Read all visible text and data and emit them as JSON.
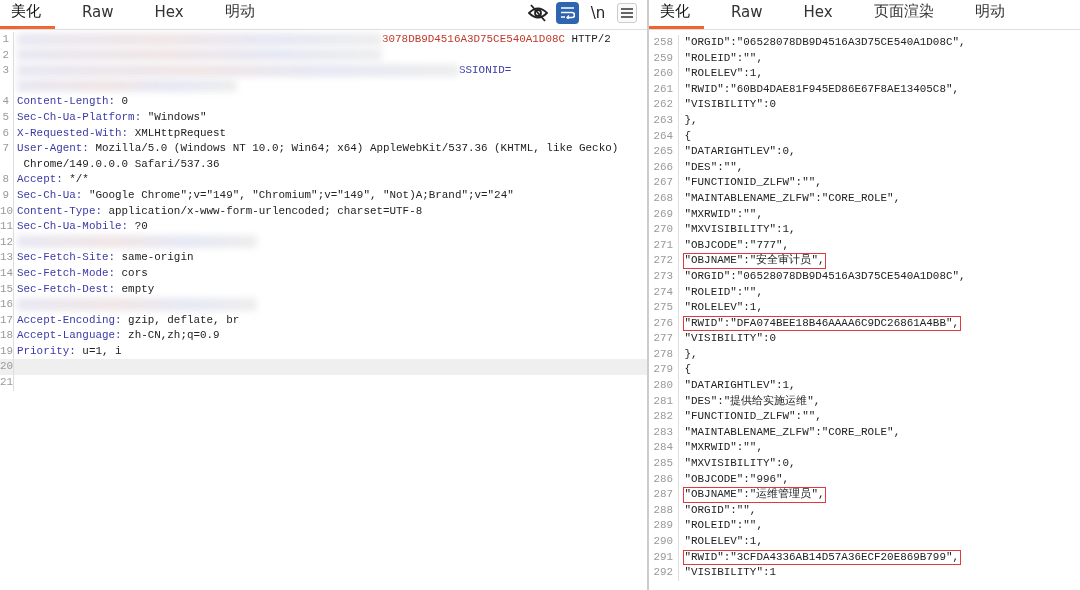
{
  "request": {
    "tabs": [
      {
        "label": "美化",
        "selected": true
      },
      {
        "label": "Raw",
        "selected": false
      },
      {
        "label": "Hex",
        "selected": false
      },
      {
        "label": "明动",
        "selected": false
      }
    ],
    "toolbar": {
      "wrap_on": true,
      "newline_label": "\\n"
    },
    "lines": [
      {
        "number": "1",
        "kind": "redacted-tail",
        "value": "3078DB9D4516A3D75CE540A1D08C",
        "suffix": " HTTP/2"
      },
      {
        "number": "2",
        "kind": "redacted"
      },
      {
        "number": "3",
        "kind": "redacted-key",
        "key": "SSIONID="
      },
      {
        "number": "4",
        "kind": "header",
        "key": "Content-Length:",
        "value": "0"
      },
      {
        "number": "5",
        "kind": "header",
        "key": "Sec-Ch-Ua-Platform:",
        "value": "\"Windows\""
      },
      {
        "number": "6",
        "kind": "header",
        "key": "X-Requested-With:",
        "value": "XMLHttpRequest"
      },
      {
        "number": "7",
        "kind": "header",
        "key": "User-Agent:",
        "value": "Mozilla/5.0 (Windows NT 10.0; Win64; x64) AppleWebKit/537.36 (KHTML, like Gecko)",
        "continuation": "Chrome/149.0.0.0 Safari/537.36"
      },
      {
        "number": "8",
        "kind": "header",
        "key": "Accept:",
        "value": "*/*"
      },
      {
        "number": "9",
        "kind": "header",
        "key": "Sec-Ch-Ua:",
        "value": "\"Google Chrome\";v=\"149\", \"Chromium\";v=\"149\", \"Not)A;Brand\";v=\"24\""
      },
      {
        "number": "10",
        "kind": "header",
        "key": "Content-Type:",
        "value": "application/x-www-form-urlencoded; charset=UTF-8"
      },
      {
        "number": "11",
        "kind": "header",
        "key": "Sec-Ch-Ua-Mobile:",
        "value": "?0"
      },
      {
        "number": "12",
        "kind": "redacted"
      },
      {
        "number": "13",
        "kind": "header",
        "key": "Sec-Fetch-Site:",
        "value": "same-origin"
      },
      {
        "number": "14",
        "kind": "header",
        "key": "Sec-Fetch-Mode:",
        "value": "cors"
      },
      {
        "number": "15",
        "kind": "header",
        "key": "Sec-Fetch-Dest:",
        "value": "empty"
      },
      {
        "number": "16",
        "kind": "redacted"
      },
      {
        "number": "17",
        "kind": "header",
        "key": "Accept-Encoding:",
        "value": "gzip, deflate, br"
      },
      {
        "number": "18",
        "kind": "header",
        "key": "Accept-Language:",
        "value": "zh-CN,zh;q=0.9"
      },
      {
        "number": "19",
        "kind": "header",
        "key": "Priority:",
        "value": "u=1, i"
      },
      {
        "number": "20",
        "kind": "empty",
        "current": true
      },
      {
        "number": "21",
        "kind": "empty",
        "current": false
      }
    ]
  },
  "response": {
    "tabs": [
      {
        "label": "美化",
        "selected": true
      },
      {
        "label": "Raw",
        "selected": false
      },
      {
        "label": "Hex",
        "selected": false
      },
      {
        "label": "页面渲染",
        "selected": false
      },
      {
        "label": "明动",
        "selected": false
      }
    ],
    "lines": [
      {
        "number": "258",
        "text": "\"ORGID\":\"06528078DB9D4516A3D75CE540A1D08C\",",
        "highlighted": false
      },
      {
        "number": "259",
        "text": "\"ROLEID\":\"\",",
        "highlighted": false
      },
      {
        "number": "260",
        "text": "\"ROLELEV\":1,",
        "highlighted": false
      },
      {
        "number": "261",
        "text": "\"RWID\":\"60BD4DAE81F945ED86E67F8AE13405C8\",",
        "highlighted": false
      },
      {
        "number": "262",
        "text": "\"VISIBILITY\":0",
        "highlighted": false
      },
      {
        "number": "263",
        "text": "},",
        "highlighted": false
      },
      {
        "number": "264",
        "text": "{",
        "highlighted": false
      },
      {
        "number": "265",
        "text": "\"DATARIGHTLEV\":0,",
        "highlighted": false
      },
      {
        "number": "266",
        "text": "\"DES\":\"\",",
        "highlighted": false
      },
      {
        "number": "267",
        "text": "\"FUNCTIONID_ZLFW\":\"\",",
        "highlighted": false
      },
      {
        "number": "268",
        "text": "\"MAINTABLENAME_ZLFW\":\"CORE_ROLE\",",
        "highlighted": false
      },
      {
        "number": "269",
        "text": "\"MXRWID\":\"\",",
        "highlighted": false
      },
      {
        "number": "270",
        "text": "\"MXVISIBILITY\":1,",
        "highlighted": false
      },
      {
        "number": "271",
        "text": "\"OBJCODE\":\"777\",",
        "highlighted": false
      },
      {
        "number": "272",
        "text": "\"OBJNAME\":\"安全审计员\",",
        "highlighted": true
      },
      {
        "number": "273",
        "text": "\"ORGID\":\"06528078DB9D4516A3D75CE540A1D08C\",",
        "highlighted": false
      },
      {
        "number": "274",
        "text": "\"ROLEID\":\"\",",
        "highlighted": false
      },
      {
        "number": "275",
        "text": "\"ROLELEV\":1,",
        "highlighted": false
      },
      {
        "number": "276",
        "text": "\"RWID\":\"DFA074BEE18B46AAAA6C9DC26861A4BB\",",
        "highlighted": true
      },
      {
        "number": "277",
        "text": "\"VISIBILITY\":0",
        "highlighted": false
      },
      {
        "number": "278",
        "text": "},",
        "highlighted": false
      },
      {
        "number": "279",
        "text": "{",
        "highlighted": false
      },
      {
        "number": "280",
        "text": "\"DATARIGHTLEV\":1,",
        "highlighted": false
      },
      {
        "number": "281",
        "text": "\"DES\":\"提供给实施运维\",",
        "highlighted": false
      },
      {
        "number": "282",
        "text": "\"FUNCTIONID_ZLFW\":\"\",",
        "highlighted": false
      },
      {
        "number": "283",
        "text": "\"MAINTABLENAME_ZLFW\":\"CORE_ROLE\",",
        "highlighted": false
      },
      {
        "number": "284",
        "text": "\"MXRWID\":\"\",",
        "highlighted": false
      },
      {
        "number": "285",
        "text": "\"MXVISIBILITY\":0,",
        "highlighted": false
      },
      {
        "number": "286",
        "text": "\"OBJCODE\":\"996\",",
        "highlighted": false
      },
      {
        "number": "287",
        "text": "\"OBJNAME\":\"运维管理员\",",
        "highlighted": true
      },
      {
        "number": "288",
        "text": "\"ORGID\":\"\",",
        "highlighted": false
      },
      {
        "number": "289",
        "text": "\"ROLEID\":\"\",",
        "highlighted": false
      },
      {
        "number": "290",
        "text": "\"ROLELEV\":1,",
        "highlighted": false
      },
      {
        "number": "291",
        "text": "\"RWID\":\"3CFDA4336AB14D57A36ECF20E869B799\",",
        "highlighted": true
      },
      {
        "number": "292",
        "text": "\"VISIBILITY\":1",
        "highlighted": false
      }
    ]
  }
}
